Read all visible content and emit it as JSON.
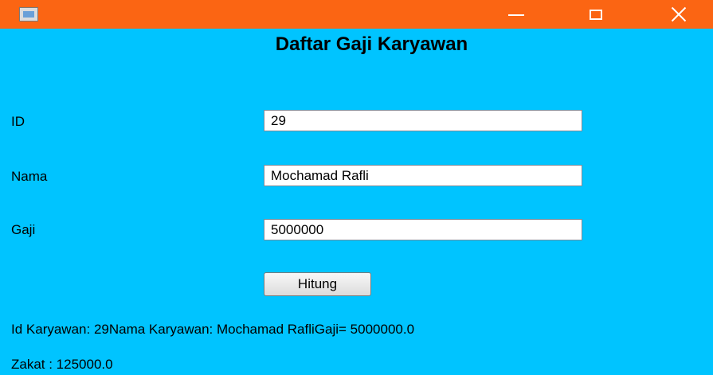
{
  "window": {
    "icon": "java-app-icon",
    "controls": {
      "minimize": "minimize-icon",
      "maximize": "maximize-icon",
      "close": "close-icon"
    },
    "titlebar_color": "#fb6513",
    "background_color": "#00c4ff"
  },
  "form": {
    "heading": "Daftar Gaji Karyawan",
    "fields": {
      "id": {
        "label": "ID",
        "value": "29"
      },
      "nama": {
        "label": "Nama",
        "value": "Mochamad Rafli"
      },
      "gaji": {
        "label": "Gaji",
        "value": "5000000"
      }
    },
    "button_label": "Hitung"
  },
  "output": {
    "line1": "Id Karyawan: 29Nama Karyawan: Mochamad RafliGaji= 5000000.0",
    "line2": "Zakat : 125000.0"
  }
}
